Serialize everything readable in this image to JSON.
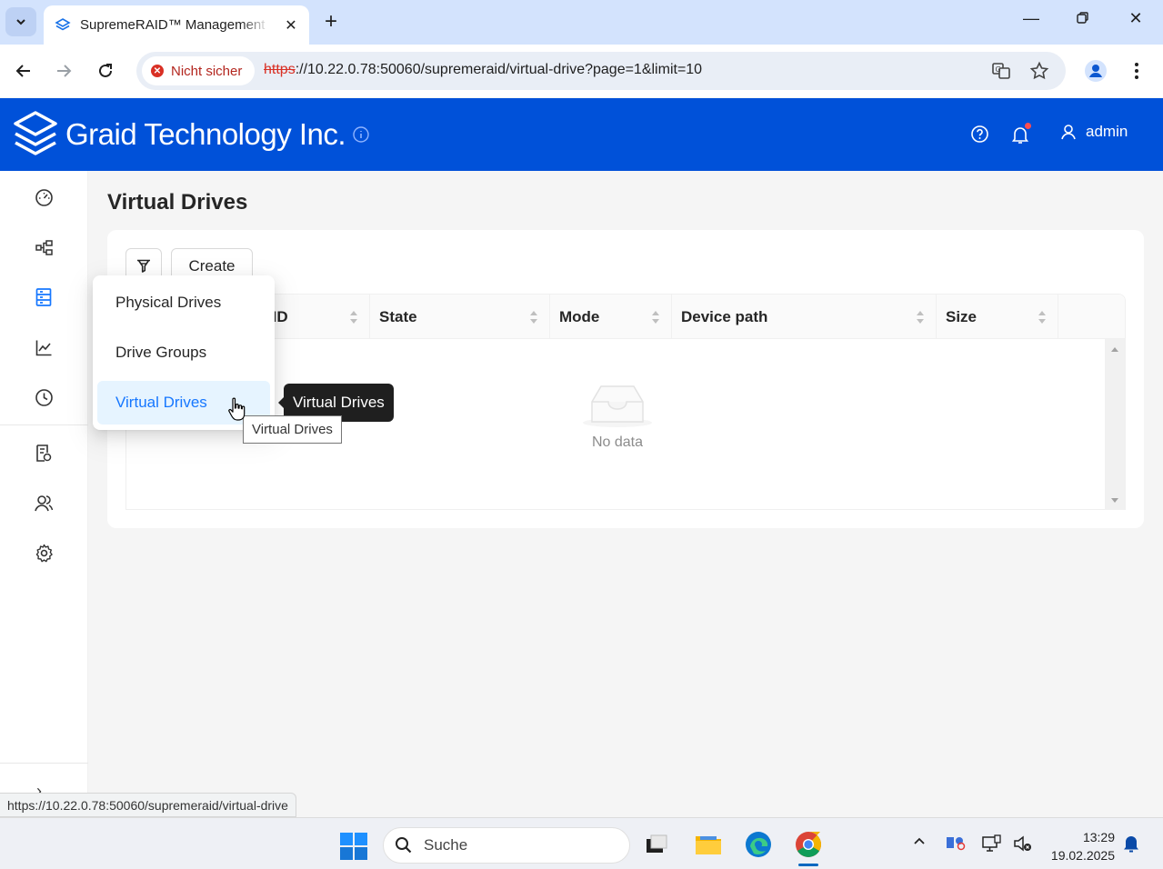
{
  "browser": {
    "tab_title": "SupremeRAID™ Management C",
    "security_chip": "Nicht sicher",
    "url_scheme": "https",
    "url_rest": "://10.22.0.78:50060/supremeraid/virtual-drive?page=1&limit=10",
    "status_url": "https://10.22.0.78:50060/supremeraid/virtual-drive"
  },
  "header": {
    "brand": "Graid Technology Inc.",
    "user": "admin",
    "accent": "#0051d9"
  },
  "page": {
    "title": "Virtual Drives",
    "create_label": "Create",
    "columns": [
      "-ID",
      "State",
      "Mode",
      "Device path",
      "Size"
    ],
    "empty_text": "No data"
  },
  "menu": {
    "items": [
      "Physical Drives",
      "Drive Groups",
      "Virtual Drives"
    ],
    "active_index": 2
  },
  "tooltip": "Virtual Drives",
  "native_tooltip": "Virtual Drives",
  "taskbar": {
    "search_placeholder": "Suche",
    "time": "13:29",
    "date": "19.02.2025"
  }
}
